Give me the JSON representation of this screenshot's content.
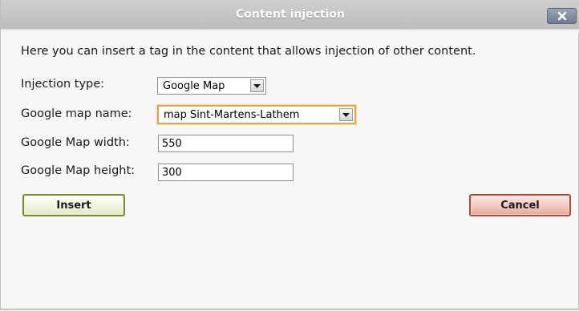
{
  "dialog": {
    "title": "Content injection",
    "close_icon": "close-icon"
  },
  "intro_text": "Here you can insert a tag in the content that allows injection of other content.",
  "fields": {
    "injection_type": {
      "label": "Injection type:",
      "value": "Google Map"
    },
    "map_name": {
      "label": "Google map name:",
      "value": "map Sint-Martens-Lathem"
    },
    "map_width": {
      "label": "Google Map width:",
      "value": "550"
    },
    "map_height": {
      "label": "Google Map height:",
      "value": "300"
    }
  },
  "buttons": {
    "insert_label": "Insert",
    "cancel_label": "Cancel"
  },
  "colors": {
    "title_text": "#ffffff",
    "insert_border": "#7c8a2a",
    "cancel_border": "#b54a3c",
    "focus_border": "#e0a94a"
  }
}
